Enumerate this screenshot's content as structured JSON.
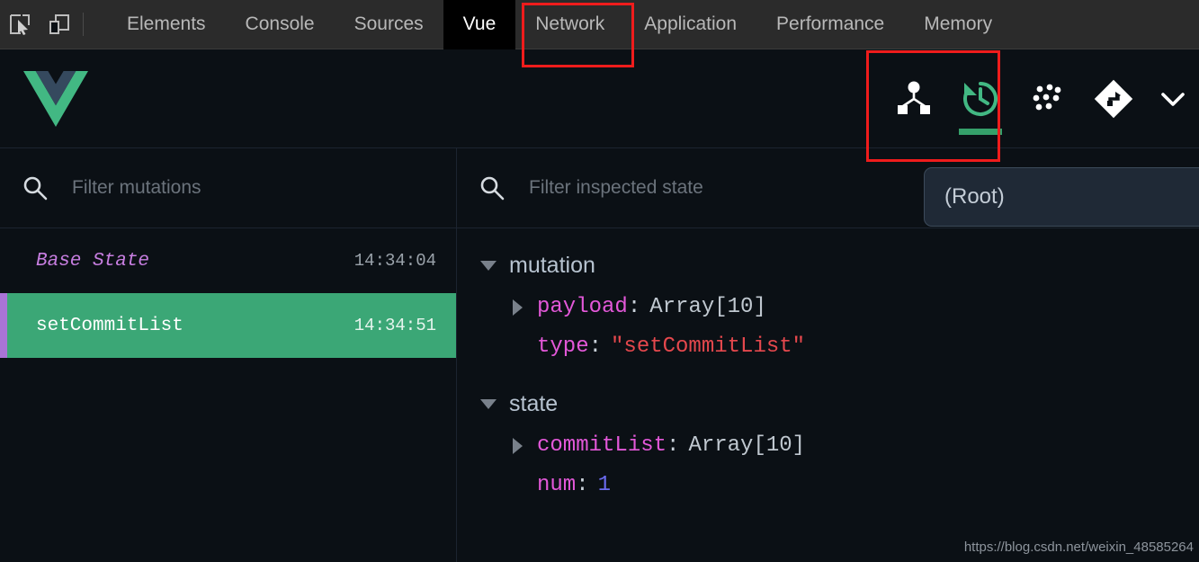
{
  "devtools": {
    "left_icons": [
      {
        "name": "inspect-element-icon",
        "label": "Inspect element"
      },
      {
        "name": "device-toolbar-icon",
        "label": "Toggle device toolbar"
      }
    ],
    "tabs": [
      {
        "label": "Elements",
        "active": false
      },
      {
        "label": "Console",
        "active": false
      },
      {
        "label": "Sources",
        "active": false
      },
      {
        "label": "Vue",
        "active": true
      },
      {
        "label": "Network",
        "active": false
      },
      {
        "label": "Application",
        "active": false
      },
      {
        "label": "Performance",
        "active": false
      },
      {
        "label": "Memory",
        "active": false
      }
    ]
  },
  "vue_panel": {
    "logo": "vue-logo",
    "actions": [
      {
        "name": "components-tab-icon",
        "label": "Components",
        "active": false
      },
      {
        "name": "vuex-history-tab-icon",
        "label": "Vuex",
        "active": true
      },
      {
        "name": "events-tab-icon",
        "label": "Events",
        "active": false
      },
      {
        "name": "routing-tab-icon",
        "label": "Routing",
        "active": false
      },
      {
        "name": "more-tabs-chevron-icon",
        "label": "More",
        "active": false
      }
    ]
  },
  "mutations_panel": {
    "filter": {
      "placeholder": "Filter mutations",
      "value": ""
    },
    "rows": [
      {
        "name": "Base State",
        "time": "14:34:04",
        "base": true,
        "active": false
      },
      {
        "name": "setCommitList",
        "time": "14:34:51",
        "base": false,
        "active": true
      }
    ]
  },
  "inspector_panel": {
    "filter": {
      "placeholder": "Filter inspected state",
      "value": ""
    },
    "root_select": {
      "value": "(Root)"
    },
    "groups": [
      {
        "title": "mutation",
        "expanded": true,
        "rows": [
          {
            "key": "payload",
            "value": "Array[10]",
            "value_type": "gray",
            "expandable": true
          },
          {
            "key": "type",
            "value": "\"setCommitList\"",
            "value_type": "string",
            "expandable": false
          }
        ]
      },
      {
        "title": "state",
        "expanded": true,
        "rows": [
          {
            "key": "commitList",
            "value": "Array[10]",
            "value_type": "gray",
            "expandable": true
          },
          {
            "key": "num",
            "value": "1",
            "value_type": "number",
            "expandable": false
          }
        ]
      }
    ]
  },
  "annotations": [
    {
      "name": "annotation-box-vue-tab",
      "color": "#ef1c1c"
    },
    {
      "name": "annotation-box-vuex-icon",
      "color": "#ef1c1c"
    }
  ],
  "watermark": {
    "text": "https://blog.csdn.net/weixin_48585264"
  },
  "colors": {
    "vue_green": "#42b883",
    "active_row": "#3ba776",
    "accent_purple": "#a974d6",
    "panel_bg": "#0b1015",
    "devtools_bar_bg": "#2b2b2b",
    "annotation_red": "#ef1c1c"
  }
}
